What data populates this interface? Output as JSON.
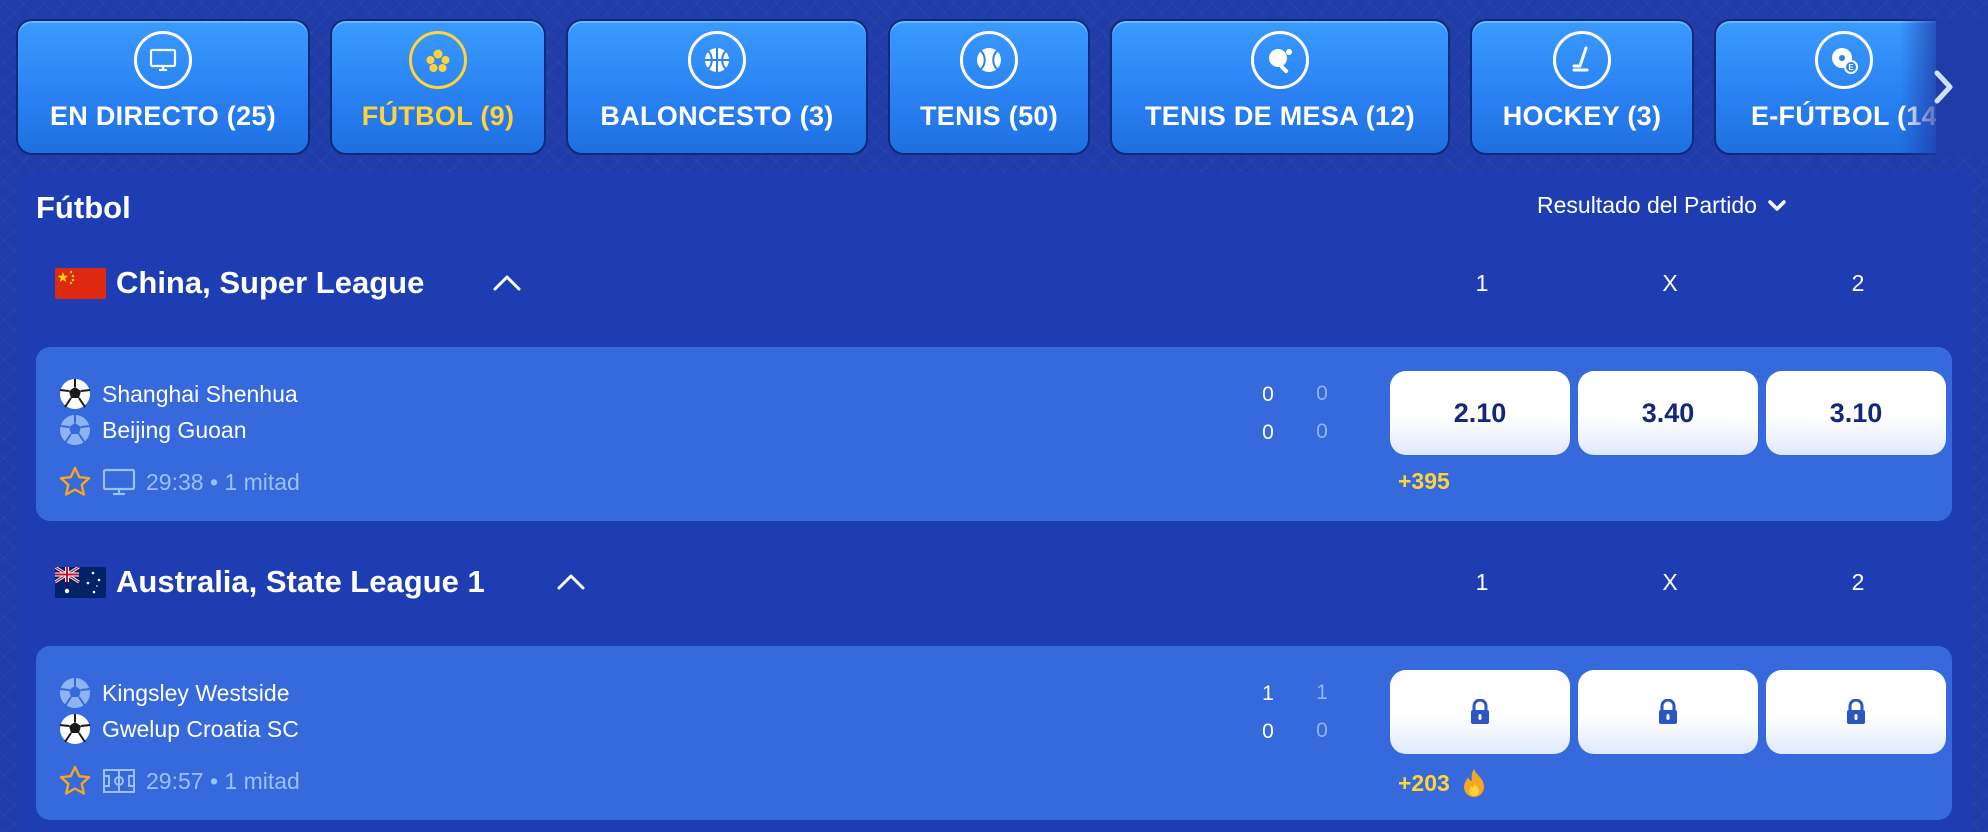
{
  "tabs": [
    {
      "label": "EN DIRECTO (25)",
      "icon": "monitor-icon",
      "active": false
    },
    {
      "label": "FÚTBOL (9)",
      "icon": "soccer-ball-icon",
      "active": true
    },
    {
      "label": "BALONCESTO (3)",
      "icon": "basketball-icon",
      "active": false
    },
    {
      "label": "TENIS (50)",
      "icon": "tennis-ball-icon",
      "active": false
    },
    {
      "label": "TENIS DE MESA (12)",
      "icon": "ping-pong-icon",
      "active": false
    },
    {
      "label": "HOCKEY (3)",
      "icon": "hockey-stick-icon",
      "active": false
    },
    {
      "label": "E-FÚTBOL (14",
      "icon": "esoccer-icon",
      "active": false
    }
  ],
  "section": {
    "title": "Fútbol",
    "market": "Resultado del Partido"
  },
  "leagues": [
    {
      "name": "China, Super League",
      "flag": "china-flag",
      "columns": [
        "1",
        "X",
        "2"
      ],
      "match": {
        "home": "Shanghai Shenhua",
        "away": "Beijing Guoan",
        "home_score": "0",
        "home_sub": "0",
        "away_score": "0",
        "away_sub": "0",
        "time": "29:38 • 1 mitad",
        "odds": [
          "2.10",
          "3.40",
          "3.10"
        ],
        "more": "+395"
      }
    },
    {
      "name": "Australia, State League 1",
      "flag": "australia-flag",
      "columns": [
        "1",
        "X",
        "2"
      ],
      "match": {
        "home": "Kingsley Westside",
        "away": "Gwelup Croatia SC",
        "home_score": "1",
        "home_sub": "1",
        "away_score": "0",
        "away_sub": "0",
        "time": "29:57 • 1 mitad",
        "odds_locked": true,
        "more": "+203"
      }
    }
  ],
  "colors": {
    "background": "#1f3ca8",
    "panel": "#1f3db3",
    "card": "#3669dc",
    "accent": "#ffd43b",
    "odd_text": "#13287a"
  }
}
